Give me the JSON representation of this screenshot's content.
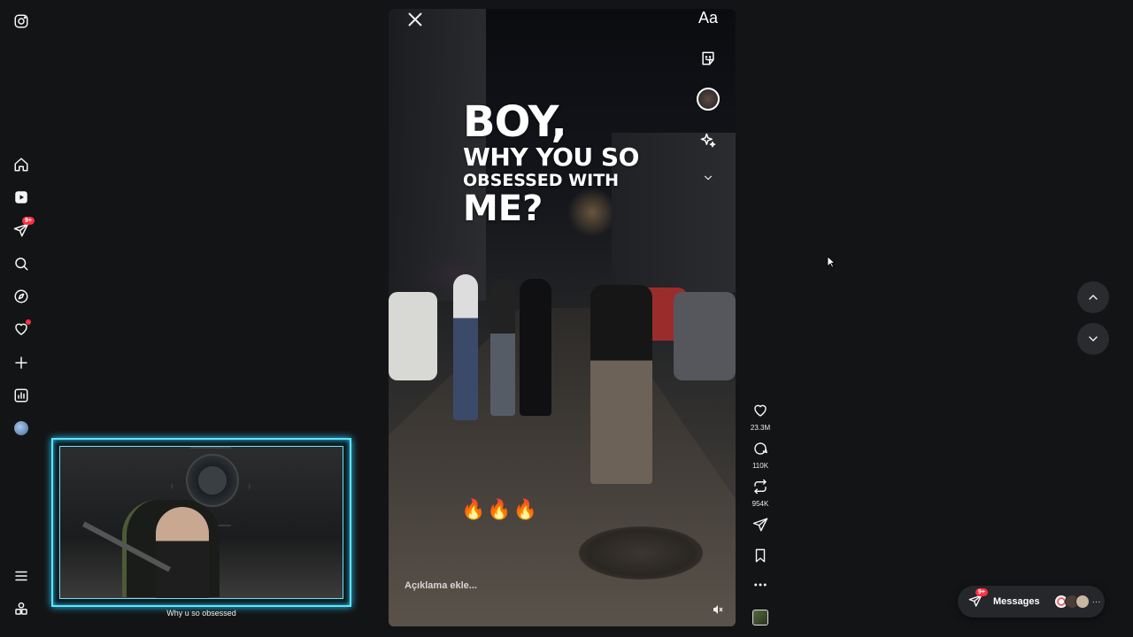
{
  "nav": {
    "notifications_badge": "9+",
    "items": [
      "instagram-logo",
      "home",
      "reels",
      "messages",
      "search",
      "explore",
      "notifications",
      "create",
      "dashboard",
      "profile",
      "more",
      "also-from-meta"
    ]
  },
  "reel": {
    "headline": {
      "line1": "BOY,",
      "line2": "WHY YOU SO",
      "line3": "OBSESSED WITH",
      "line4": "ME?"
    },
    "emoji": "🔥🔥🔥",
    "caption_placeholder": "Açıklama ekle...",
    "tools": {
      "text_tool": "Aa"
    }
  },
  "actions": {
    "likes": "23.3M",
    "comments": "110K",
    "reposts": "954K"
  },
  "messages": {
    "label": "Messages",
    "badge": "9+",
    "more": "···"
  },
  "webcam": {
    "label": "Why u so obsessed"
  },
  "colors": {
    "background": "#131416",
    "accent_badge": "#ff3040",
    "cam_border": "#5fe4ff"
  }
}
